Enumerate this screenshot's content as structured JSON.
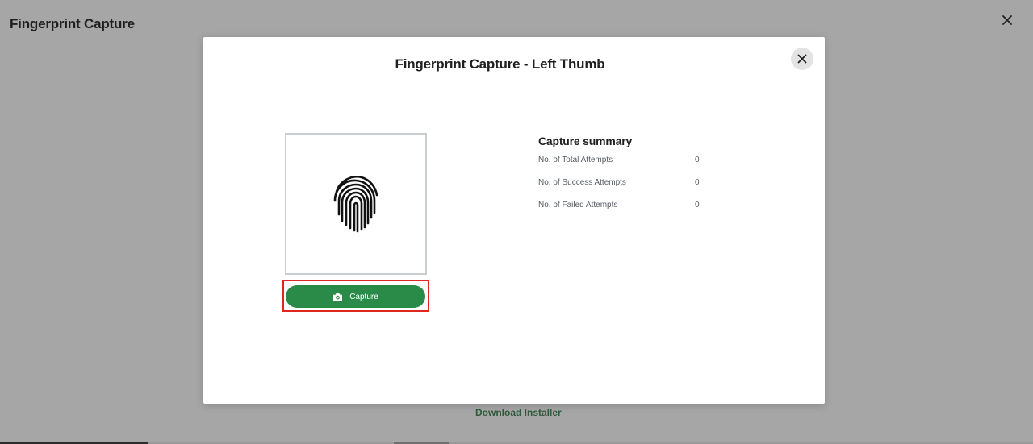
{
  "page": {
    "title": "Fingerprint Capture",
    "download_link": "Download Installer"
  },
  "modal": {
    "title": "Fingerprint Capture - Left Thumb",
    "capture_button_label": "Capture",
    "summary": {
      "title": "Capture summary",
      "rows": [
        {
          "label": "No. of Total Attempts",
          "value": "0"
        },
        {
          "label": "No. of Success Attempts",
          "value": "0"
        },
        {
          "label": "No. of Failed Attempts",
          "value": "0"
        }
      ]
    }
  },
  "icons": {
    "page_close": "close-icon",
    "modal_close": "close-icon",
    "fingerprint": "fingerprint-icon",
    "capture": "camera-icon"
  },
  "colors": {
    "overlay": "#a6a6a6",
    "accent_green": "#2a8a47",
    "highlight_red": "#e0271f",
    "link_green": "#2f5a3c"
  }
}
